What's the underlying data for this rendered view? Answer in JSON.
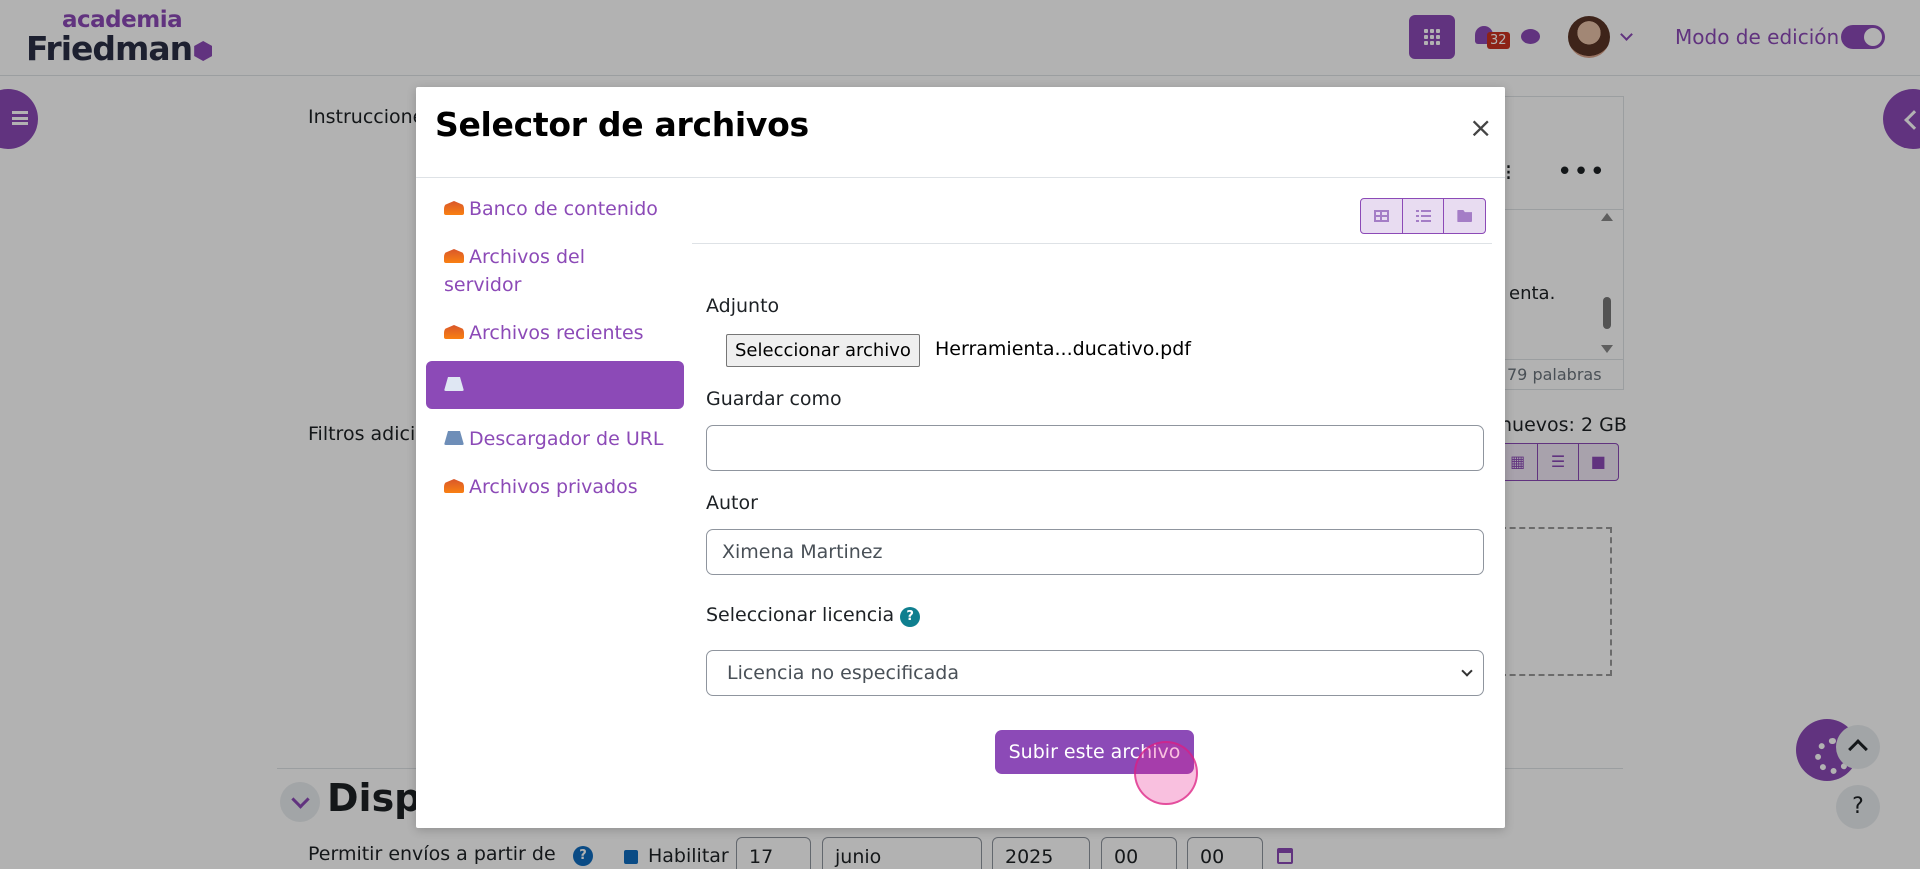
{
  "header": {
    "logo_line1": "academia",
    "logo_line2": "Friedman",
    "notification_count": "32",
    "edit_mode_label": "Modo de edición",
    "edit_mode_on": true
  },
  "background": {
    "instructions_label": "Instruccione",
    "filters_label": "Filtros adici",
    "editor_text": "enta.",
    "word_count": "79 palabras",
    "quota_text": "nuevos: 2 GB",
    "section_title": "Dispo",
    "allow_label": "Permitir envíos a partir de",
    "enable_label": "Habilitar",
    "day": "17",
    "month": "junio",
    "year": "2025",
    "hour": "00",
    "minute": "00"
  },
  "modal": {
    "title": "Selector de archivos",
    "close_symbol": "×",
    "repositories": [
      {
        "label": "Banco de contenido",
        "icon": "moodle-icon"
      },
      {
        "label": "Archivos del servidor",
        "icon": "moodle-icon"
      },
      {
        "label": "Archivos recientes",
        "icon": "moodle-icon"
      },
      {
        "label": "",
        "icon": "upload-icon",
        "active": true
      },
      {
        "label": "Descargador de URL",
        "icon": "upload-icon"
      },
      {
        "label": "Archivos privados",
        "icon": "moodle-icon"
      }
    ],
    "view_modes": [
      "grid-icon",
      "list-icon",
      "folder-icon"
    ],
    "attachment_label": "Adjunto",
    "choose_file_button": "Seleccionar archivo",
    "chosen_file": "Herramienta...ducativo.pdf",
    "save_as_label": "Guardar como",
    "save_as_value": "",
    "author_label": "Autor",
    "author_value": "Ximena Martinez",
    "license_label": "Seleccionar licencia",
    "license_value": "Licencia no especificada",
    "upload_button": "Subir este archivo"
  },
  "colors": {
    "brand": "#8c4ab7",
    "overlay": "rgba(0,0,0,0.3)",
    "help": "#0f7f8f"
  }
}
